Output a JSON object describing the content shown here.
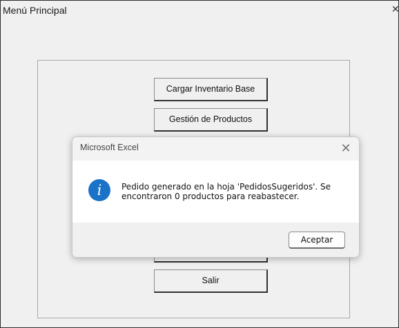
{
  "window": {
    "title": "Menú Principal",
    "close_icon": "close-icon"
  },
  "menu": {
    "buttons": [
      {
        "label": "Cargar Inventario Base"
      },
      {
        "label": "Gestión de Productos"
      },
      {
        "label": ""
      },
      {
        "label": "Salir"
      }
    ]
  },
  "dialog": {
    "title": "Microsoft Excel",
    "icon": "info-icon",
    "icon_glyph": "i",
    "message": "Pedido generado en la hoja 'PedidosSugeridos'. Se encontraron 0 productos para reabastecer.",
    "ok_label": "Aceptar",
    "close_glyph": "✕"
  },
  "colors": {
    "info_blue": "#1a73c9",
    "window_bg": "#f0f0f0"
  }
}
